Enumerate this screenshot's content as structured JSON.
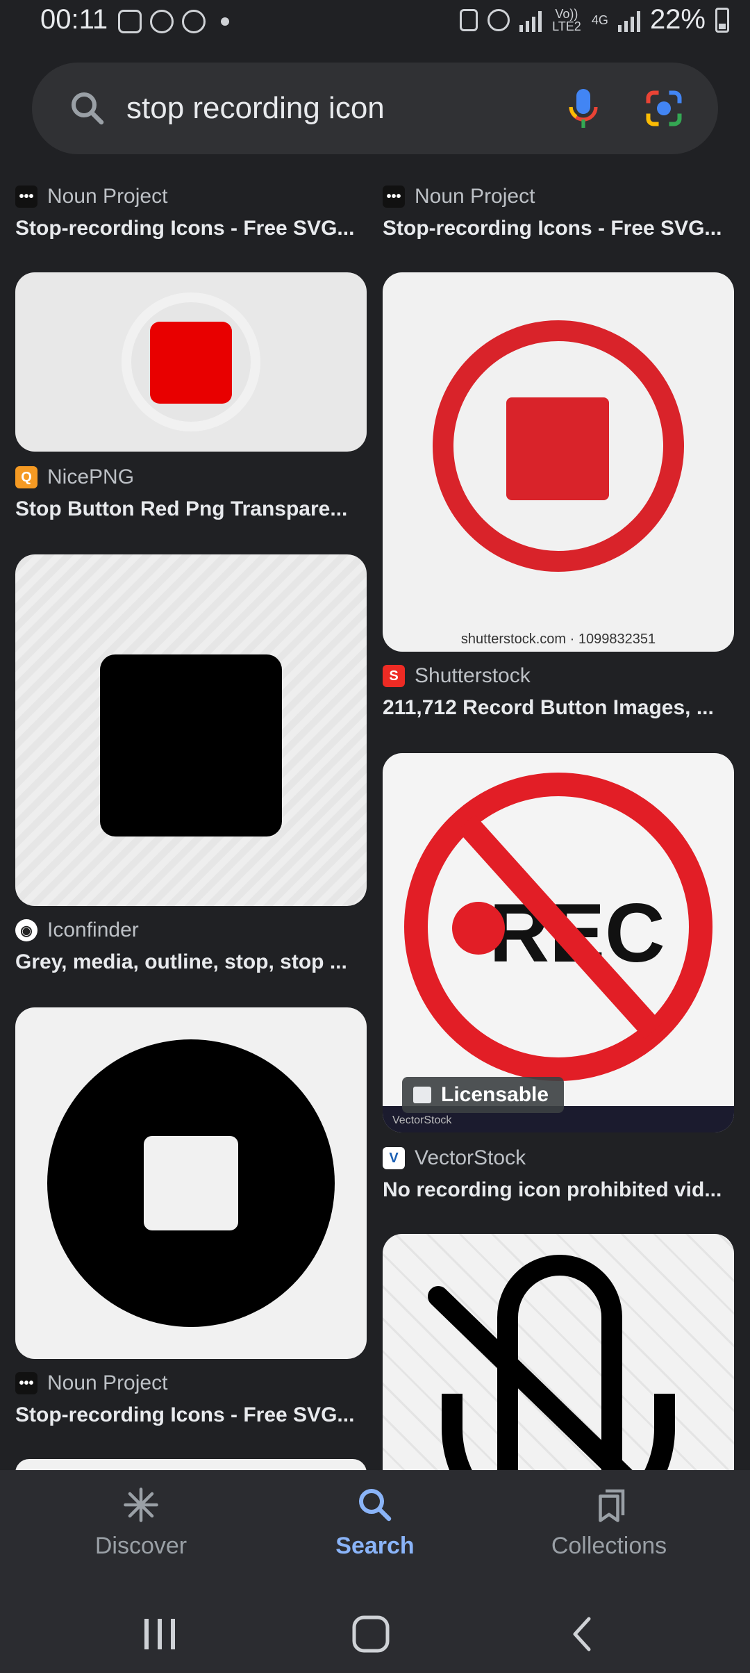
{
  "status": {
    "time": "00:11",
    "network_lte": "Vo)) LTE2",
    "network_4g": "4G",
    "battery": "22%"
  },
  "search": {
    "query": "stop recording icon",
    "icons": [
      "search-icon",
      "mic-icon",
      "lens-icon"
    ]
  },
  "results": {
    "left": [
      {
        "source": "Noun Project",
        "title": "Stop-recording Icons - Free SVG..."
      },
      {
        "source": "NicePNG",
        "title": "Stop Button Red Png Transpare..."
      },
      {
        "source": "Iconfinder",
        "title": "Grey, media, outline, stop, stop ..."
      },
      {
        "source": "Noun Project",
        "title": "Stop-recording Icons - Free SVG..."
      }
    ],
    "right": [
      {
        "source": "Noun Project",
        "title": "Stop-recording Icons - Free SVG..."
      },
      {
        "source": "Shutterstock",
        "title": "211,712 Record Button Images, ...",
        "watermark": "shutterstock.com · 1099832351"
      },
      {
        "source": "VectorStock",
        "title": "No recording icon prohibited vid...",
        "badge": "Licensable",
        "overlay_text": "REC",
        "watermark": "VectorStock"
      }
    ]
  },
  "nav": {
    "discover": "Discover",
    "search": "Search",
    "collections": "Collections"
  },
  "colors": {
    "background": "#202124",
    "accent": "#8ab4f8",
    "stop_red": "#e21e26"
  }
}
